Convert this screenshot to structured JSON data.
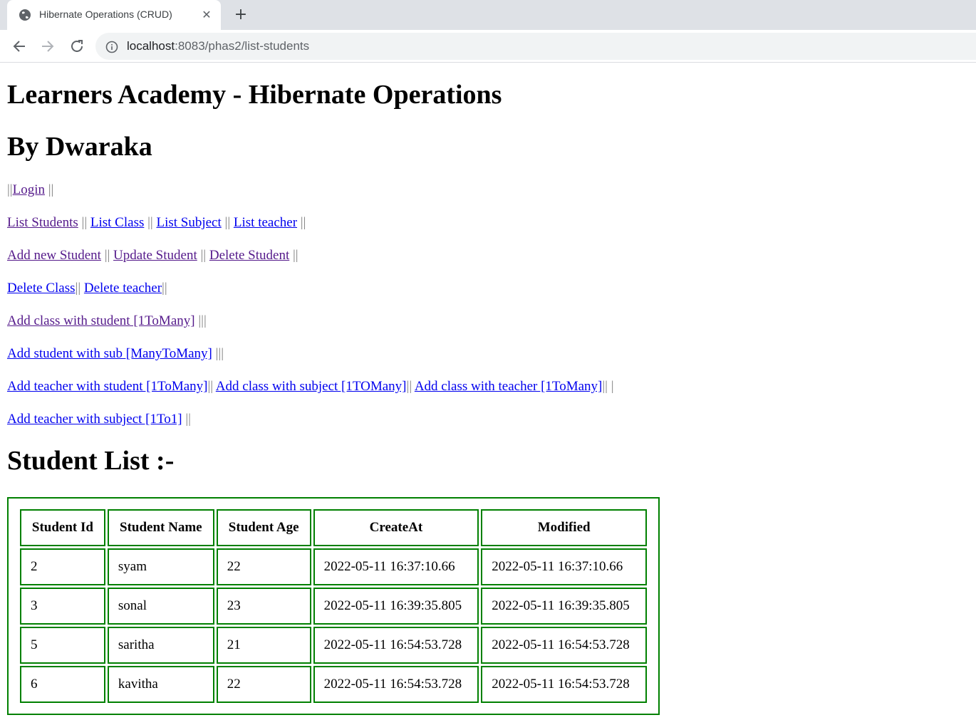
{
  "browser": {
    "tab_title": "Hibernate Operations (CRUD)",
    "url_host": "localhost",
    "url_rest": ":8083/phas2/list-students"
  },
  "page": {
    "heading": "Learners Academy - Hibernate Operations",
    "author": "By Dwaraka",
    "list_title": "Student List :-"
  },
  "nav": {
    "line1": {
      "pre": "||",
      "login": "Login",
      "post": " ||"
    },
    "line2": {
      "list_students": "List Students",
      "sep1": " || ",
      "list_class": "List Class",
      "sep2": " || ",
      "list_subject": "List Subject",
      "sep3": " || ",
      "list_teacher": "List teacher",
      "sep4": " ||"
    },
    "line3": {
      "add_student": "Add new Student",
      "sep1": " || ",
      "update_student": "Update Student",
      "sep2": " || ",
      "delete_student": "Delete Student",
      "sep3": " ||"
    },
    "line4": {
      "delete_class": "Delete Class",
      "sep1": "|| ",
      "delete_teacher": "Delete teacher",
      "sep2": "||"
    },
    "line5": {
      "add_class_student": "Add class with student [1ToMany]",
      "sep1": " |||"
    },
    "line6": {
      "add_student_sub": "Add student with sub [ManyToMany]",
      "sep1": " |||"
    },
    "line7": {
      "add_teacher_student": "Add teacher with student [1ToMany]",
      "sep1": "|| ",
      "add_class_subject": "Add class with subject [1TOMany]",
      "sep2": "|| ",
      "add_class_teacher": "Add class with teacher [1ToMany]",
      "sep3": "|| |"
    },
    "line8": {
      "add_teacher_subject": "Add teacher with subject [1To1]",
      "sep1": " ||"
    }
  },
  "table": {
    "headers": [
      "Student Id",
      "Student Name",
      "Student Age",
      "CreateAt",
      "Modified"
    ],
    "rows": [
      [
        "2",
        "syam",
        "22",
        "2022-05-11 16:37:10.66",
        "2022-05-11 16:37:10.66"
      ],
      [
        "3",
        "sonal",
        "23",
        "2022-05-11 16:39:35.805",
        "2022-05-11 16:39:35.805"
      ],
      [
        "5",
        "saritha",
        "21",
        "2022-05-11 16:54:53.728",
        "2022-05-11 16:54:53.728"
      ],
      [
        "6",
        "kavitha",
        "22",
        "2022-05-11 16:54:53.728",
        "2022-05-11 16:54:53.728"
      ]
    ]
  }
}
